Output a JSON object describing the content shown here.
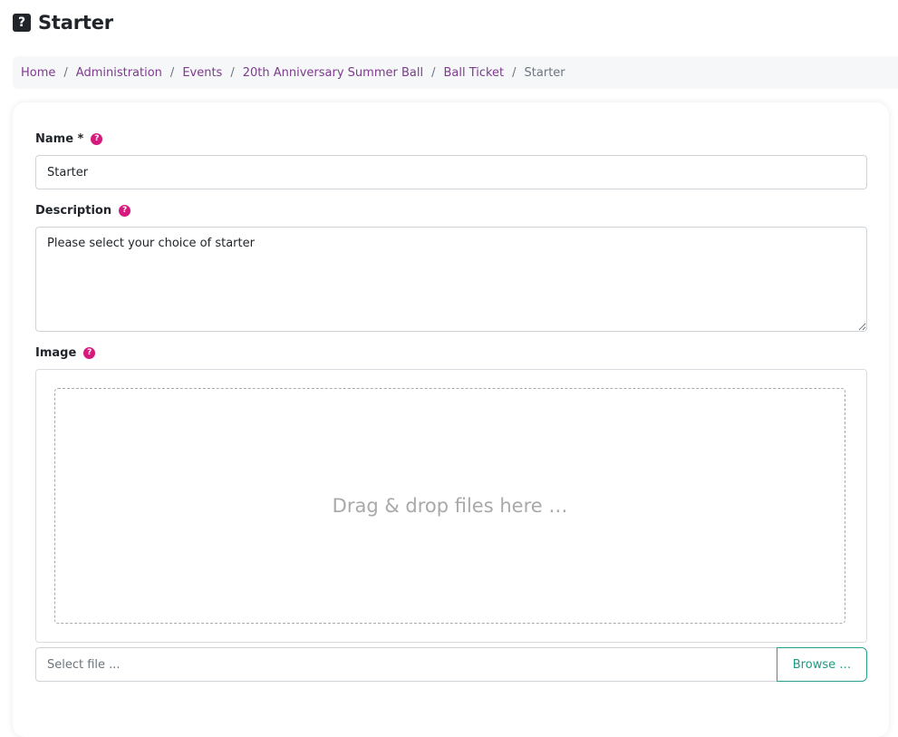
{
  "header": {
    "icon": "question-square-icon",
    "icon_glyph": "?",
    "title": "Starter"
  },
  "breadcrumb": [
    {
      "label": "Home",
      "active": false
    },
    {
      "label": "Administration",
      "active": false
    },
    {
      "label": "Events",
      "active": false
    },
    {
      "label": "20th Anniversary Summer Ball",
      "active": false
    },
    {
      "label": "Ball Ticket",
      "active": false
    },
    {
      "label": "Starter",
      "active": true
    }
  ],
  "breadcrumb_separator": "/",
  "form": {
    "name": {
      "label": "Name *",
      "help_glyph": "?",
      "value": "Starter"
    },
    "description": {
      "label": "Description",
      "help_glyph": "?",
      "value": "Please select your choice of starter"
    },
    "image": {
      "label": "Image",
      "help_glyph": "?",
      "dropzone_text": "Drag & drop files here …",
      "file_caption_placeholder": "Select file ...",
      "browse_label": "Browse …"
    }
  },
  "colors": {
    "link": "#7d3b8c",
    "help_icon": "#d6197c",
    "browse_accent": "#28a08c"
  }
}
